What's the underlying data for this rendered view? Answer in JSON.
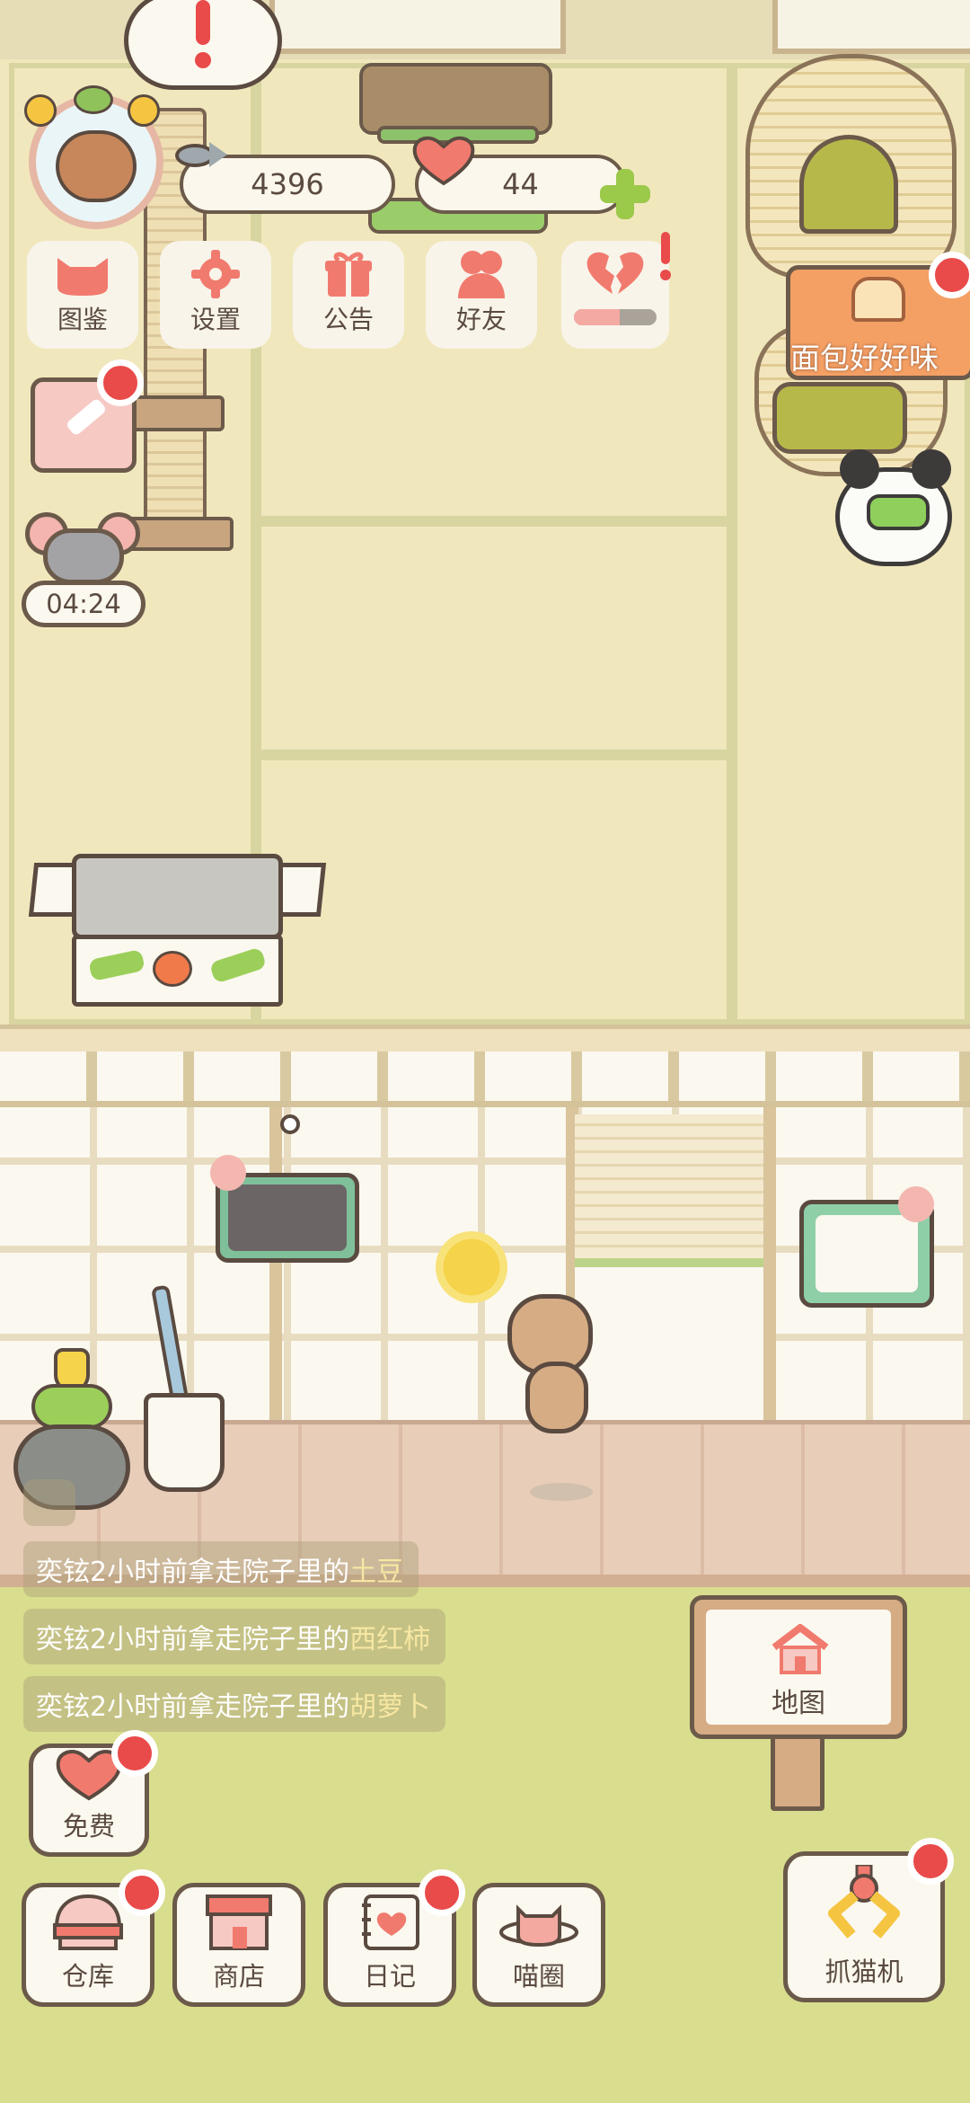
{
  "hud": {
    "fish_coins": "4396",
    "hearts": "44",
    "timer": "04:24",
    "banner_text": "面包好好味"
  },
  "menu": [
    {
      "label": "图鉴",
      "icon": "cat-head-icon"
    },
    {
      "label": "设置",
      "icon": "gear-icon"
    },
    {
      "label": "公告",
      "icon": "gift-icon"
    },
    {
      "label": "好友",
      "icon": "friends-icon"
    }
  ],
  "feed": [
    {
      "prefix": "奕铉2小时前拿走院子里的",
      "item": "土豆"
    },
    {
      "prefix": "奕铉2小时前拿走院子里的",
      "item": "西红柿"
    },
    {
      "prefix": "奕铉2小时前拿走院子里的",
      "item": "胡萝卜"
    }
  ],
  "map_sign": {
    "label": "地图"
  },
  "free_button": {
    "label": "免费"
  },
  "bottom_bar": [
    {
      "label": "仓库",
      "icon": "warehouse-icon"
    },
    {
      "label": "商店",
      "icon": "shop-icon"
    },
    {
      "label": "日记",
      "icon": "diary-icon"
    },
    {
      "label": "喵圈",
      "icon": "planet-cat-icon"
    }
  ],
  "claw_machine": {
    "label": "抓猫机"
  },
  "colors": {
    "accent_red": "#e94a4a",
    "heart_pink": "#f17a6e",
    "outline_brown": "#6b5a4a",
    "grass_green": "#d9dd8e",
    "plus_green": "#9bc94a"
  }
}
